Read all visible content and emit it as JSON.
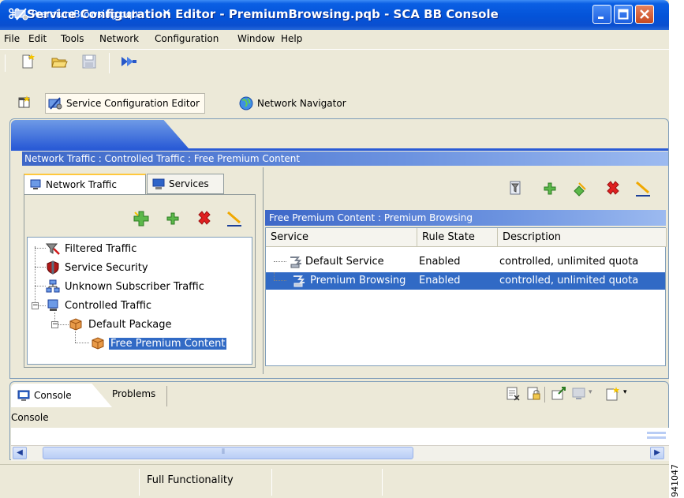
{
  "window": {
    "title": "Service Configuration Editor - PremiumBrowsing.pqb - SCA BB Console",
    "title_glyph": "⌘",
    "side_code": "941047"
  },
  "menu": [
    "File",
    "Edit",
    "Tools",
    "Network",
    "Configuration",
    "Window",
    "Help"
  ],
  "perspectives": {
    "service_config_editor": "Service Configuration Editor",
    "network_navigator": "Network Navigator"
  },
  "editor": {
    "tab_label": "PremiumBrowsing.pqb",
    "close_glyph": "✕",
    "breadcrumb": "Network Traffic : Controlled Traffic : Free Premium Content"
  },
  "left_tabs": {
    "network_traffic": "Network Traffic",
    "services": "Services"
  },
  "tree": [
    {
      "label": "Filtered Traffic",
      "icon": "filter-icon"
    },
    {
      "label": "Service Security",
      "icon": "shield-icon"
    },
    {
      "label": "Unknown Subscriber Traffic",
      "icon": "network-icon"
    },
    {
      "label": "Controlled Traffic",
      "icon": "monitor-icon",
      "expanded": true
    },
    {
      "label": "Default Package",
      "icon": "package-icon",
      "expanded": true
    },
    {
      "label": "Free Premium Content",
      "icon": "package-icon",
      "selected": true
    }
  ],
  "right_pane": {
    "title": "Free Premium Content : Premium Browsing",
    "columns": [
      "Service",
      "Rule State",
      "Description"
    ],
    "rows": [
      {
        "service": "Default Service",
        "state": "Enabled",
        "description": "controlled, unlimited quota",
        "selected": false
      },
      {
        "service": "Premium Browsing",
        "state": "Enabled",
        "description": "controlled, unlimited quota",
        "selected": true
      }
    ]
  },
  "console": {
    "tab_label": "Console",
    "problems_label": "Problems",
    "label": "Console",
    "scroll_grip": "⦀"
  },
  "status": {
    "text": "Full Functionality"
  },
  "colors": {
    "selection": "#316ac5",
    "title_bar": "#0453d8",
    "breadcrumb_bar": "#3d67c8"
  }
}
